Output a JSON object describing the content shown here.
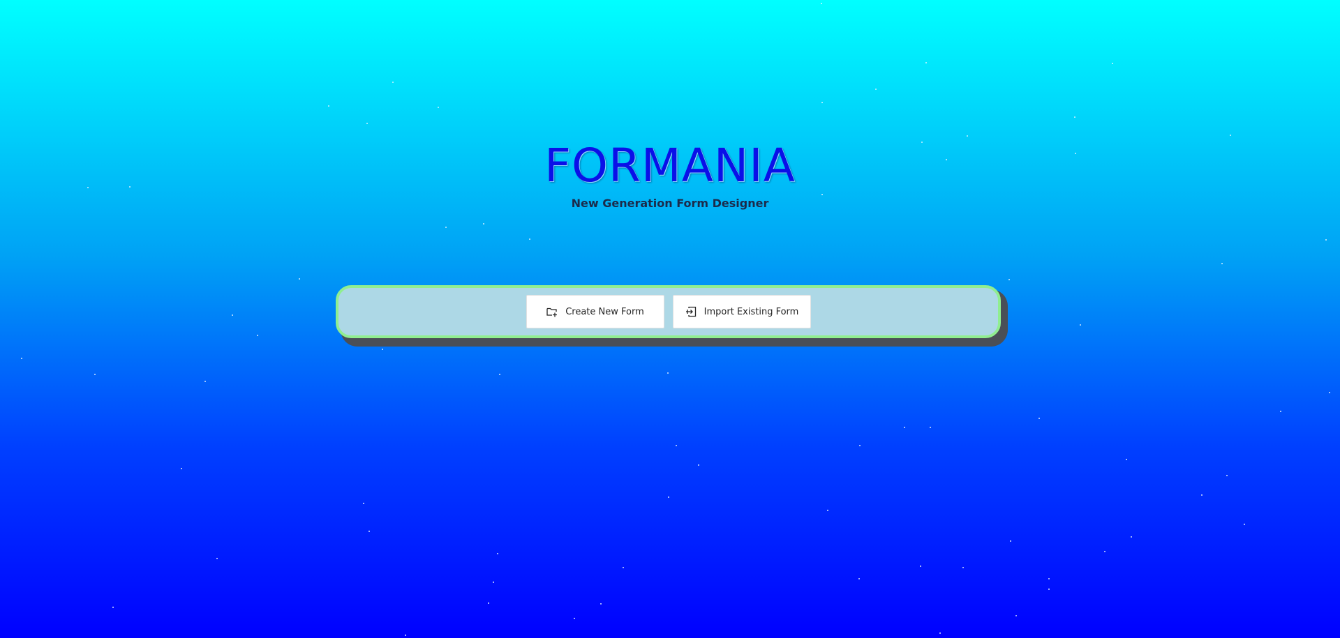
{
  "app": {
    "title": "FORMANIA",
    "subtitle": "New Generation Form Designer"
  },
  "toolbar": {
    "create_label": "Create New Form",
    "create_icon": "folder-add-icon",
    "import_label": "Import Existing Form",
    "import_icon": "import-icon"
  },
  "colors": {
    "background_top": "#00ffff",
    "background_bottom": "#0000ff",
    "title": "#0a10e8",
    "toolbar_fill": "#add8e6",
    "toolbar_border": "#90ee90",
    "toolbar_shadow": "#4a4f57"
  }
}
